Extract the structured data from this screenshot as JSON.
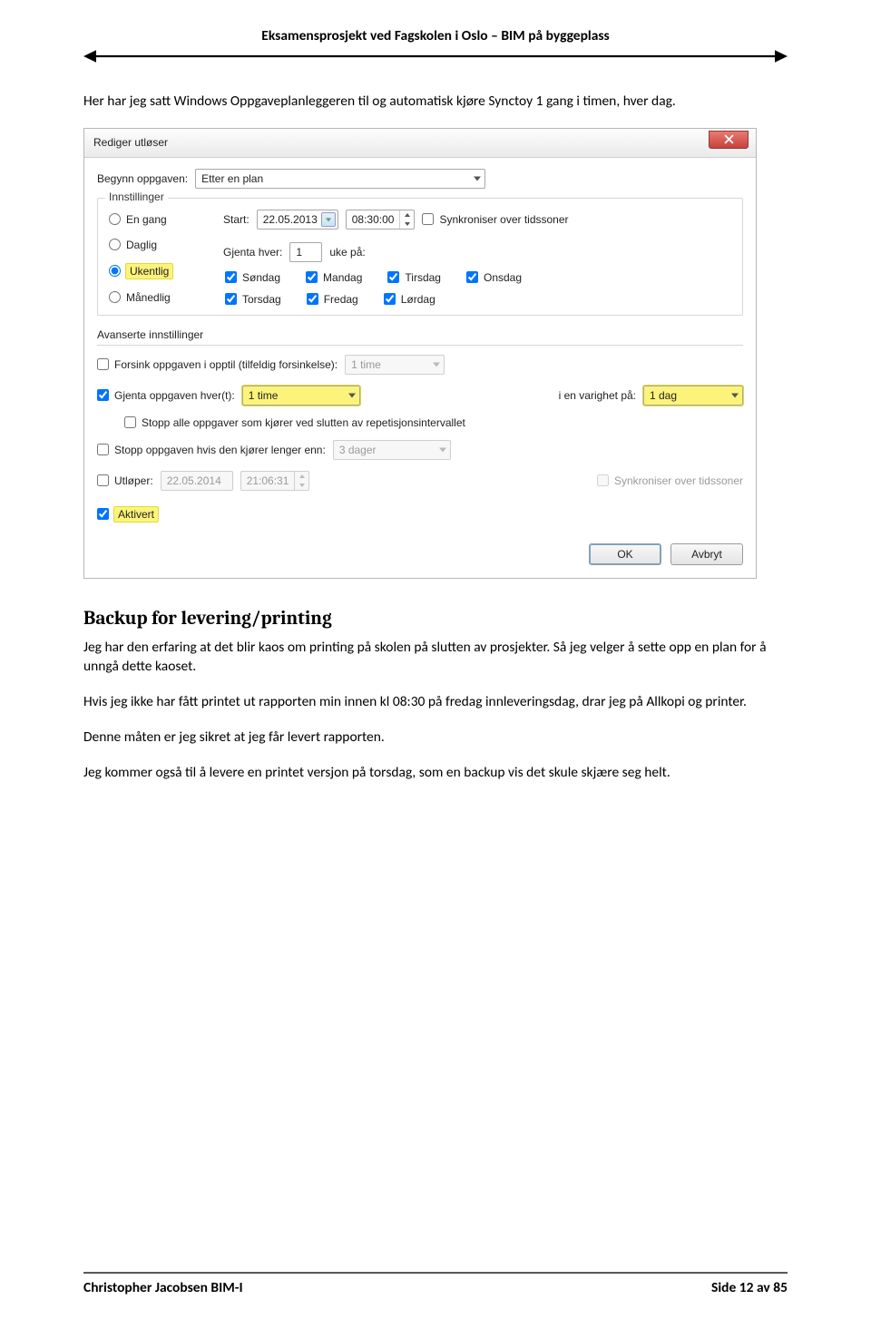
{
  "header": {
    "title": "Eksamensprosjekt ved Fagskolen i Oslo – BIM på byggeplass"
  },
  "intro_para": "Her har jeg satt Windows Oppgaveplanleggeren til og automatisk kjøre Synctoy 1 gang i timen, hver dag.",
  "dialog": {
    "title": "Rediger utløser",
    "begin_label": "Begynn oppgaven:",
    "begin_value": "Etter en plan",
    "settings_legend": "Innstillinger",
    "radios": {
      "once": "En gang",
      "daily": "Daglig",
      "weekly": "Ukentlig",
      "monthly": "Månedlig"
    },
    "start_label": "Start:",
    "start_date": "22.05.2013",
    "start_time": "08:30:00",
    "sync_tz": "Synkroniser over tidssoner",
    "repeat_every_label": "Gjenta hver:",
    "repeat_every_value": "1",
    "repeat_every_suffix": "uke på:",
    "days": {
      "sun": "Søndag",
      "mon": "Mandag",
      "tue": "Tirsdag",
      "wed": "Onsdag",
      "thu": "Torsdag",
      "fri": "Fredag",
      "sat": "Lørdag"
    },
    "adv_title": "Avanserte innstillinger",
    "adv_delay": "Forsink oppgaven i opptil (tilfeldig forsinkelse):",
    "adv_delay_val": "1 time",
    "adv_repeat": "Gjenta oppgaven hver(t):",
    "adv_repeat_val": "1 time",
    "adv_duration_label": "i en varighet på:",
    "adv_duration_val": "1 dag",
    "adv_stop_all": "Stopp alle oppgaver som kjører ved slutten av repetisjonsintervallet",
    "adv_stop_if": "Stopp oppgaven hvis den kjører lenger enn:",
    "adv_stop_if_val": "3 dager",
    "adv_expire": "Utløper:",
    "adv_expire_date": "22.05.2014",
    "adv_expire_time": "21:06:31",
    "adv_sync_tz": "Synkroniser over tidssoner",
    "adv_enabled": "Aktivert",
    "ok": "OK",
    "cancel": "Avbryt"
  },
  "section_heading": "Backup for levering/printing",
  "para1": "Jeg har den erfaring at det blir kaos om printing på skolen på slutten av prosjekter. Så jeg velger å sette opp en plan for å unngå dette kaoset.",
  "para2": "Hvis jeg ikke har fått printet ut rapporten min innen kl 08:30 på fredag innleveringsdag, drar jeg på Allkopi og printer.",
  "para3": "Denne måten er jeg sikret at jeg får levert rapporten.",
  "para4": "Jeg kommer også til å levere en printet versjon på torsdag, som en backup vis det skule skjære seg helt.",
  "footer": {
    "left": "Christopher Jacobsen BIM-I",
    "right": "Side 12 av 85"
  }
}
